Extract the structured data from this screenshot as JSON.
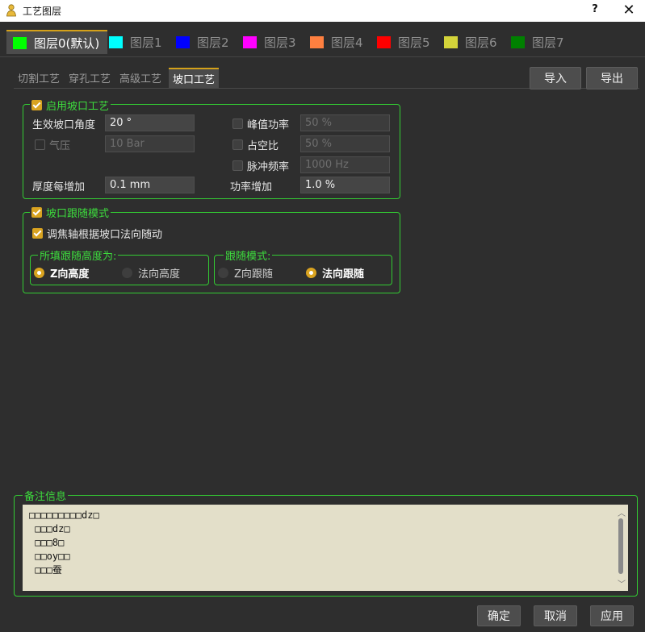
{
  "window": {
    "title": "工艺图层",
    "help": "?",
    "close": "✕"
  },
  "layer_tabs": [
    {
      "label": "图层0(默认)",
      "color": "#00ff00"
    },
    {
      "label": "图层1",
      "color": "#00ffff"
    },
    {
      "label": "图层2",
      "color": "#0000ff"
    },
    {
      "label": "图层3",
      "color": "#ff00ff"
    },
    {
      "label": "图层4",
      "color": "#ff8040"
    },
    {
      "label": "图层5",
      "color": "#ff0000"
    },
    {
      "label": "图层6",
      "color": "#d4d43a"
    },
    {
      "label": "图层7",
      "color": "#008000"
    }
  ],
  "process_tabs": [
    "切割工艺",
    "穿孔工艺",
    "高级工艺",
    "坡口工艺"
  ],
  "toolbar": {
    "import": "导入",
    "export": "导出"
  },
  "bevel": {
    "title": "启用坡口工艺",
    "angle_label": "生效坡口角度",
    "angle_value": "20 °",
    "gas_label": "气压",
    "gas_value": "10 Bar",
    "thickness_label": "厚度每增加",
    "thickness_value": "0.1 mm",
    "peak_label": "峰值功率",
    "peak_value": "50 %",
    "duty_label": "占空比",
    "duty_value": "50 %",
    "freq_label": "脉冲频率",
    "freq_value": "1000 Hz",
    "power_inc_label": "功率增加",
    "power_inc_value": "1.0 %"
  },
  "follow": {
    "title": "坡口跟随模式",
    "focus_label": "调焦轴根据坡口法向随动",
    "height_group": "所填跟随高度为:",
    "height_opt1": "Z向高度",
    "height_opt2": "法向高度",
    "mode_group": "跟随模式:",
    "mode_opt1": "Z向跟随",
    "mode_opt2": "法向跟随"
  },
  "notes": {
    "title": "备注信息",
    "lines": [
      "□□□□□□□□□dz□",
      " □□□dz□",
      " □□□8□",
      " □□oy□□",
      " □□□蚕"
    ]
  },
  "footer": {
    "ok": "确定",
    "cancel": "取消",
    "apply": "应用"
  }
}
